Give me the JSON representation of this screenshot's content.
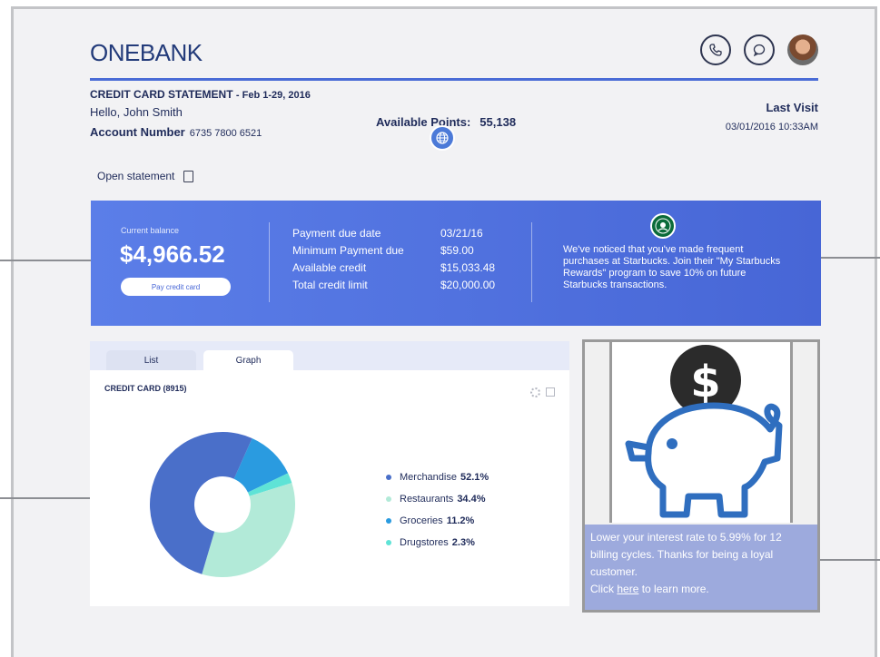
{
  "header": {
    "logo": "ONEBANK",
    "icons": [
      "phone-icon",
      "chat-icon",
      "user-avatar"
    ]
  },
  "statement": {
    "title": "CREDIT CARD STATEMENT",
    "date_range": "- Feb 1-29, 2016",
    "greeting": "Hello, John Smith",
    "account_label": "Account Number",
    "account_number": "6735 7800 6521",
    "points_label": "Available Points:",
    "points_value": "55,138",
    "last_visit_label": "Last Visit",
    "last_visit_value": "03/01/2016 10:33AM",
    "open_statement": "Open statement"
  },
  "summary": {
    "balance_label": "Current balance",
    "balance_value": "$4,966.52",
    "pay_button": "Pay credit card",
    "rows": [
      {
        "label": "Payment due date",
        "value": "03/21/16"
      },
      {
        "label": "Minimum Payment due",
        "value": "$59.00"
      },
      {
        "label": "Available credit",
        "value": "$15,033.48"
      },
      {
        "label": "Total credit limit",
        "value": "$20,000.00"
      }
    ],
    "offer_text": "We've noticed that you've made frequent purchases at Starbucks. Join their \"My Starbucks Rewards\" program to save 10% on future Starbucks transactions."
  },
  "tabs": [
    "List",
    "Graph"
  ],
  "active_tab": "Graph",
  "chart_panel": {
    "label": "CREDIT CARD (8915)"
  },
  "chart_data": {
    "type": "pie",
    "donut": true,
    "categories": [
      "Merchandise",
      "Restaurants",
      "Groceries",
      "Drugstores"
    ],
    "values": [
      52.1,
      34.4,
      11.2,
      2.3
    ],
    "value_labels": [
      "52.1%",
      "34.4%",
      "11.2%",
      "2.3%"
    ],
    "colors": [
      "#4a6fc9",
      "#b2ead8",
      "#2a9be0",
      "#5fe3d6"
    ],
    "legend_position": "right"
  },
  "promo": {
    "line1": "Lower your interest rate to 5.99% for 12 billing cycles. Thanks for being a loyal customer.",
    "click": "Click",
    "link": "here",
    "after_link": "to learn more."
  },
  "colors": {
    "brand_blue": "#4766d6",
    "navy_text": "#1f2b5a",
    "promo_overlay": "#9daadd"
  }
}
